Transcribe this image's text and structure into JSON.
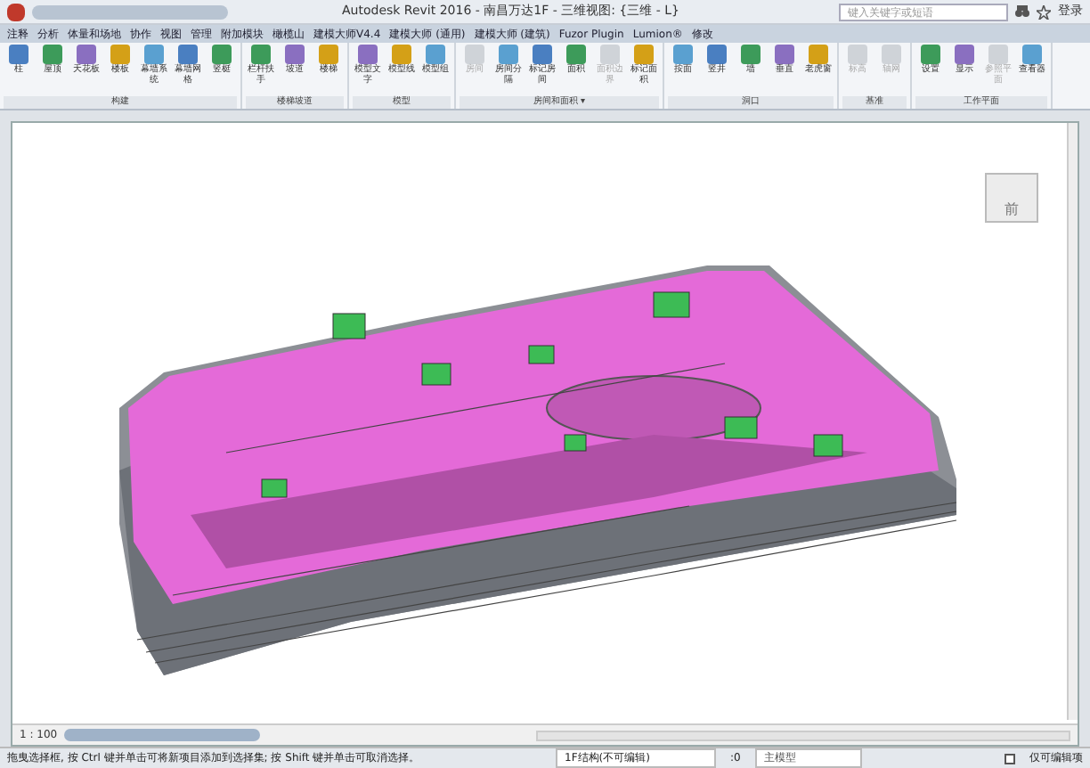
{
  "window": {
    "title": "Autodesk Revit 2016 - 南昌万达1F - 三维视图: {三维 - L}",
    "search_placeholder": "键入关键字或短语",
    "user": "登录"
  },
  "tabs": [
    {
      "label": "注释",
      "selected": false
    },
    {
      "label": "分析",
      "selected": false
    },
    {
      "label": "体量和场地",
      "selected": false
    },
    {
      "label": "协作",
      "selected": false
    },
    {
      "label": "视图",
      "selected": false
    },
    {
      "label": "管理",
      "selected": false
    },
    {
      "label": "附加模块",
      "selected": false
    },
    {
      "label": "橄榄山",
      "selected": false
    },
    {
      "label": "建模大师V4.4",
      "selected": false
    },
    {
      "label": "建模大师 (通用)",
      "selected": false
    },
    {
      "label": "建模大师 (建筑)",
      "selected": false
    },
    {
      "label": "Fuzor Plugin",
      "selected": false
    },
    {
      "label": "Lumion®",
      "selected": false
    },
    {
      "label": "修改",
      "selected": false
    }
  ],
  "panels": [
    {
      "title": "构建",
      "tools": [
        {
          "label": "柱",
          "disabled": false
        },
        {
          "label": "屋顶",
          "disabled": false
        },
        {
          "label": "天花板",
          "disabled": false
        },
        {
          "label": "楼板",
          "disabled": false
        },
        {
          "label": "幕墙系统",
          "disabled": false
        },
        {
          "label": "幕墙网格",
          "disabled": false
        },
        {
          "label": "竖梃",
          "disabled": false
        }
      ]
    },
    {
      "title": "楼梯坡道",
      "tools": [
        {
          "label": "栏杆扶手",
          "disabled": false
        },
        {
          "label": "坡道",
          "disabled": false
        },
        {
          "label": "楼梯",
          "disabled": false
        }
      ]
    },
    {
      "title": "模型",
      "tools": [
        {
          "label": "模型文字",
          "disabled": false
        },
        {
          "label": "模型线",
          "disabled": false
        },
        {
          "label": "模型组",
          "disabled": false
        }
      ]
    },
    {
      "title": "房间和面积 ▾",
      "tools": [
        {
          "label": "房间",
          "disabled": true
        },
        {
          "label": "房间分隔",
          "disabled": false
        },
        {
          "label": "标记房间",
          "disabled": false
        },
        {
          "label": "面积",
          "disabled": false
        },
        {
          "label": "面积边界",
          "disabled": true
        },
        {
          "label": "标记面积",
          "disabled": false
        }
      ]
    },
    {
      "title": "洞口",
      "tools": [
        {
          "label": "按面",
          "disabled": false
        },
        {
          "label": "竖井",
          "disabled": false
        },
        {
          "label": "墙",
          "disabled": false
        },
        {
          "label": "垂直",
          "disabled": false
        },
        {
          "label": "老虎窗",
          "disabled": false
        }
      ]
    },
    {
      "title": "基准",
      "tools": [
        {
          "label": "标高",
          "disabled": true
        },
        {
          "label": "轴网",
          "disabled": true
        }
      ]
    },
    {
      "title": "工作平面",
      "tools": [
        {
          "label": "设置",
          "disabled": false
        },
        {
          "label": "显示",
          "disabled": false
        },
        {
          "label": "参照平面",
          "disabled": true
        },
        {
          "label": "查看器",
          "disabled": false
        }
      ]
    }
  ],
  "view_cube": {
    "face": "前"
  },
  "view_control": {
    "scale": "1 : 100"
  },
  "status_bar": {
    "message": "拖曳选择框, 按 Ctrl 键并单击可将新项目添加到选择集; 按 Shift 键并单击可取消选择。",
    "workset": "1F结构(不可编辑)",
    "count": ":0",
    "design_option": "主模型",
    "editable_only": {
      "label": "仅可编辑项",
      "checked": false
    }
  }
}
